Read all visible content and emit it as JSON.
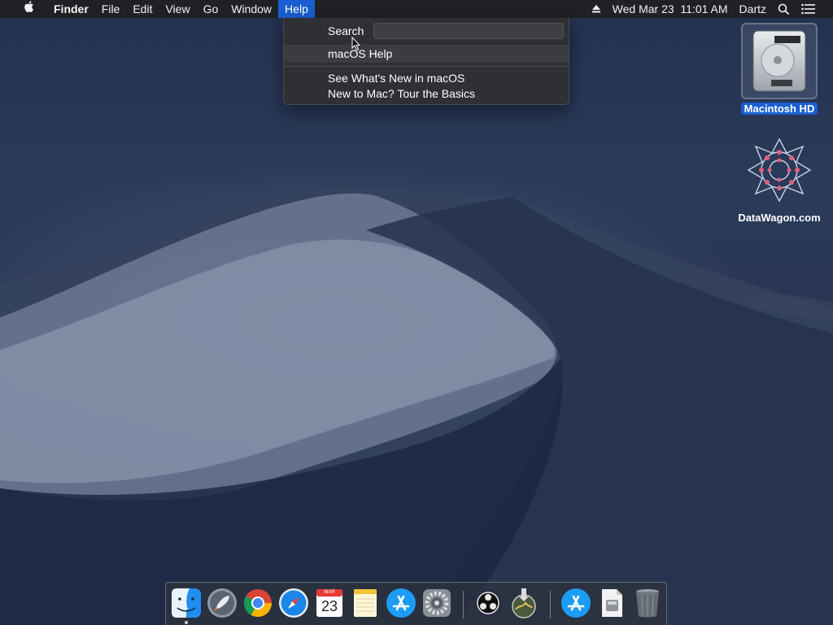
{
  "menubar": {
    "app_name": "Finder",
    "menus": [
      "File",
      "Edit",
      "View",
      "Go",
      "Window",
      "Help"
    ],
    "active_menu": "Help",
    "datetime": "Wed Mar 23  11:01 AM",
    "user": "Dartz",
    "icons": [
      "apple-icon",
      "eject-icon",
      "spotlight-icon",
      "notification-center-icon"
    ]
  },
  "help_menu": {
    "search_label": "Search",
    "search_value": "",
    "items": [
      "macOS Help",
      "See What's New in macOS",
      "New to Mac? Tour the Basics"
    ]
  },
  "desktop": {
    "icons": [
      {
        "label": "Macintosh HD",
        "icon": "hard-drive-icon",
        "selected": true
      },
      {
        "label": "DataWagon.com",
        "icon": "datawagon-logo-icon",
        "selected": false
      }
    ]
  },
  "dock": {
    "apps": [
      "Finder",
      "Launchpad",
      "Google Chrome",
      "Safari",
      "Calendar",
      "Notes",
      "App Store",
      "System Preferences",
      "OBS",
      "Installer",
      "App Store Downloads",
      "Preview Document",
      "Trash"
    ],
    "calendar_month": "MAR",
    "calendar_day": "23"
  },
  "colors": {
    "menubar_bg": "#1f2125",
    "selection": "#1a5fd1",
    "menu_bg": "#2f3034"
  }
}
